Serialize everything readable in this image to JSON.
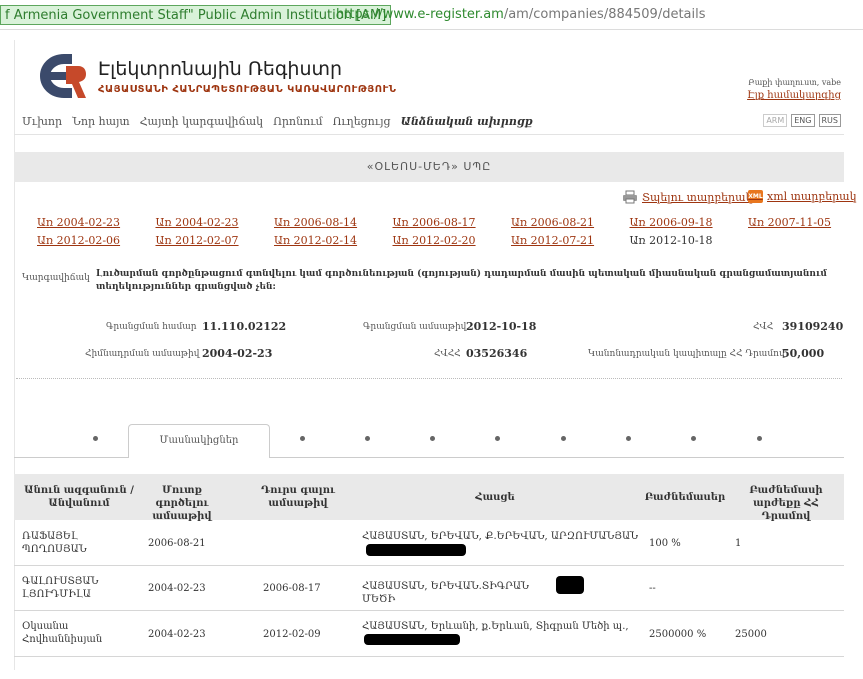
{
  "browser": {
    "site_badge": "f Armenia Government Staff\"  Public Admin Institution [AM]",
    "url_host": "https://www.e-register.am",
    "url_path": "/am/companies/884509/details"
  },
  "header": {
    "title": "Էլեկտրոնային Ռեգիստր",
    "subtitle": "ՀԱՅԱՍՏԱՆԻ ՀԱՆՐԱՊԵՏՈՒԹՅԱՆ ԿԱՌԱՎԱՐՈՒԹՅՈՒՆ",
    "search_text": "Բաքի փաղուստ, vabe",
    "login_link": "Էլք համակարգից"
  },
  "nav": {
    "items": [
      "Մւխոր",
      "Նոր հայտ",
      "Հայտի կարգավիճակ",
      "Որոնում",
      "Ուղեցույց",
      "Անձնական ախրոցք"
    ],
    "languages": [
      "ARM",
      "ENG",
      "RUS"
    ]
  },
  "company": {
    "name": "«ՕԼԵՈՍ-ՄԵԴ» ՍՊԸ"
  },
  "actions": {
    "print_label": "Տպելու տարբերակ",
    "xml_label": "xml տարբերակ",
    "xml_icon_text": "XML"
  },
  "dates": {
    "row1": [
      "Առ 2004-02-23",
      "Առ 2004-02-23",
      "Առ 2006-08-14",
      "Առ 2006-08-17",
      "Առ 2006-08-21",
      "Առ 2006-09-18",
      "Առ 2007-11-05"
    ],
    "row2": [
      "Առ 2012-02-06",
      "Առ 2012-02-07",
      "Առ 2012-02-14",
      "Առ 2012-02-20",
      "Առ 2012-07-21",
      "Առ 2012-10-18"
    ]
  },
  "status": {
    "label": "Կարգավիճակ",
    "text": "Լուծարման գործընթացում գտնվելու կամ գործունեության (գոյության) դադարման մասին պետական միասնական գրանցամատյանում տեղեկություններ գրանցված չեն:"
  },
  "info": {
    "reg_number_label": "Գրանցման համար",
    "reg_number": "11.110.02122",
    "reg_date_label": "Գրանցման ամսաթիվ",
    "reg_date": "2012-10-18",
    "hvhh_label": "ՀՎՀ",
    "hvhh": "39109240",
    "founded_label": "Հիմնադրման ամսաթիվ",
    "founded": "2004-02-23",
    "ahr_label": "ՀՎՀՀ",
    "ahr": "03526346",
    "capital_label": "Կանոնադրական կապիտալը ՀՀ Դրամով",
    "capital": "50,000"
  },
  "tabs": {
    "active_label": "Մասնակիցներ"
  },
  "table": {
    "headers": {
      "name": "Անուն ազգանուն / Անվանում",
      "entry_date": "Մուտք գործելու ամսաթիվ",
      "exit_date": "Դուրս գալու ամսաթիվ",
      "address": "Հասցե",
      "shares": "Բաժնեմասեր",
      "share_value": "Բաժնեմասի արժեքը ՀՀ Դրամով"
    },
    "rows": [
      {
        "name": "ՌԱՖԱՅԵԼ ՊՈՂՈՍՅԱՆ",
        "entry_date": "2006-08-21",
        "exit_date": "",
        "address": "ՀԱՅԱՍՏԱՆ, ԵՐԵՎԱՆ, Ք.ԵՐԵՎԱՆ, ԱՐԶՈՒՄԱՆՅԱՆ",
        "shares": "100 %",
        "share_value": "1"
      },
      {
        "name": "ԳԱԼՈՒՍՏՅԱՆ ԼՅՈՒԴՄԻԼԱ",
        "entry_date": "2004-02-23",
        "exit_date": "2006-08-17",
        "address": "ՀԱՅԱՍՏԱՆ, ԵՐԵՎԱՆ.ՏԻԳՐԱՆ ՄԵԾԻ",
        "shares": "--",
        "share_value": ""
      },
      {
        "name": "Օկսանա Հովհաննիսյան",
        "entry_date": "2004-02-23",
        "exit_date": "2012-02-09",
        "address": "ՀԱՅԱՍՏԱՆ, Երևանի, ք.Երևան, Տիգրան Մեծի պ.,",
        "shares": "2500000 %",
        "share_value": "25000"
      }
    ]
  }
}
